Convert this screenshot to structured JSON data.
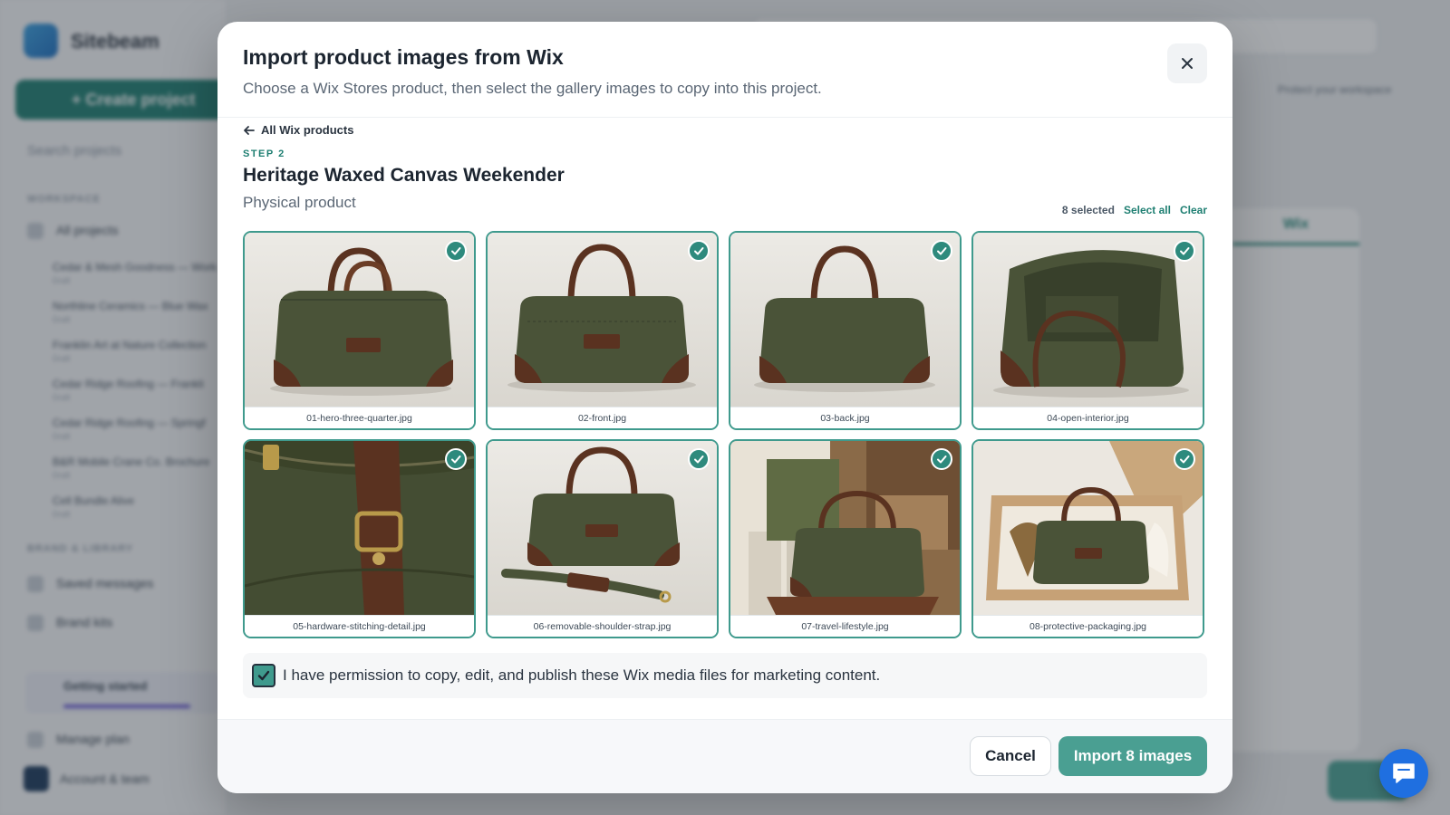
{
  "background": {
    "brand": "Sitebeam",
    "create_button": "+ Create project",
    "search_placeholder": "Search projects",
    "section_projects": "Workspace",
    "nav_all_projects": "All projects",
    "projects": [
      {
        "name": "Cedar & Mesh Goodness — Work",
        "sub": "Draft"
      },
      {
        "name": "Northline Ceramics — Blue Wax",
        "sub": "Draft"
      },
      {
        "name": "Franklin Art at Nature Collection",
        "sub": "Draft"
      },
      {
        "name": "Cedar Ridge Roofing — Frankli",
        "sub": "Draft"
      },
      {
        "name": "Cedar Ridge Roofing — Springf",
        "sub": "Draft"
      },
      {
        "name": "B&R Mobile Crane Co. Brochure",
        "sub": "Draft"
      },
      {
        "name": "Cell Bundle Alive",
        "sub": "Draft"
      }
    ],
    "section_brand": "Brand & Library",
    "nav_saved_messages": "Saved messages",
    "nav_brand_kits": "Brand kits",
    "upgrade_title": "Getting started",
    "nav_manage_plan": "Manage plan",
    "nav_account": "Account & team",
    "tab_wix": "Wix",
    "protect_text": "Protect your workspace"
  },
  "modal": {
    "title": "Import product images from Wix",
    "subtitle": "Choose a Wix Stores product, then select the gallery images to copy into this project.",
    "back_label": "All Wix products",
    "step_label": "STEP 2",
    "product_name": "Heritage Waxed Canvas Weekender",
    "product_type": "Physical product",
    "selected_count": "8 selected",
    "select_all": "Select all",
    "clear": "Clear",
    "images": [
      {
        "file": "01-hero-three-quarter.jpg",
        "selected": true
      },
      {
        "file": "02-front.jpg",
        "selected": true
      },
      {
        "file": "03-back.jpg",
        "selected": true
      },
      {
        "file": "04-open-interior.jpg",
        "selected": true
      },
      {
        "file": "05-hardware-stitching-detail.jpg",
        "selected": true
      },
      {
        "file": "06-removable-shoulder-strap.jpg",
        "selected": true
      },
      {
        "file": "07-travel-lifestyle.jpg",
        "selected": true
      },
      {
        "file": "08-protective-packaging.jpg",
        "selected": true
      }
    ],
    "permission_text": "I have permission to copy, edit, and publish these Wix media files for marketing content.",
    "permission_checked": true,
    "cancel": "Cancel",
    "import": "Import 8 images"
  },
  "colors": {
    "accent": "#1f7f72",
    "import_button": "#4a9f92",
    "card_border": "#3f9a8d",
    "bag_canvas": "#4a5338",
    "bag_leather": "#5a3220",
    "chat_button": "#1f6fe0"
  },
  "icons": {
    "close": "close-icon",
    "back": "arrow-left-icon",
    "check": "check-circle-icon",
    "chat": "chat-bubble-icon"
  }
}
